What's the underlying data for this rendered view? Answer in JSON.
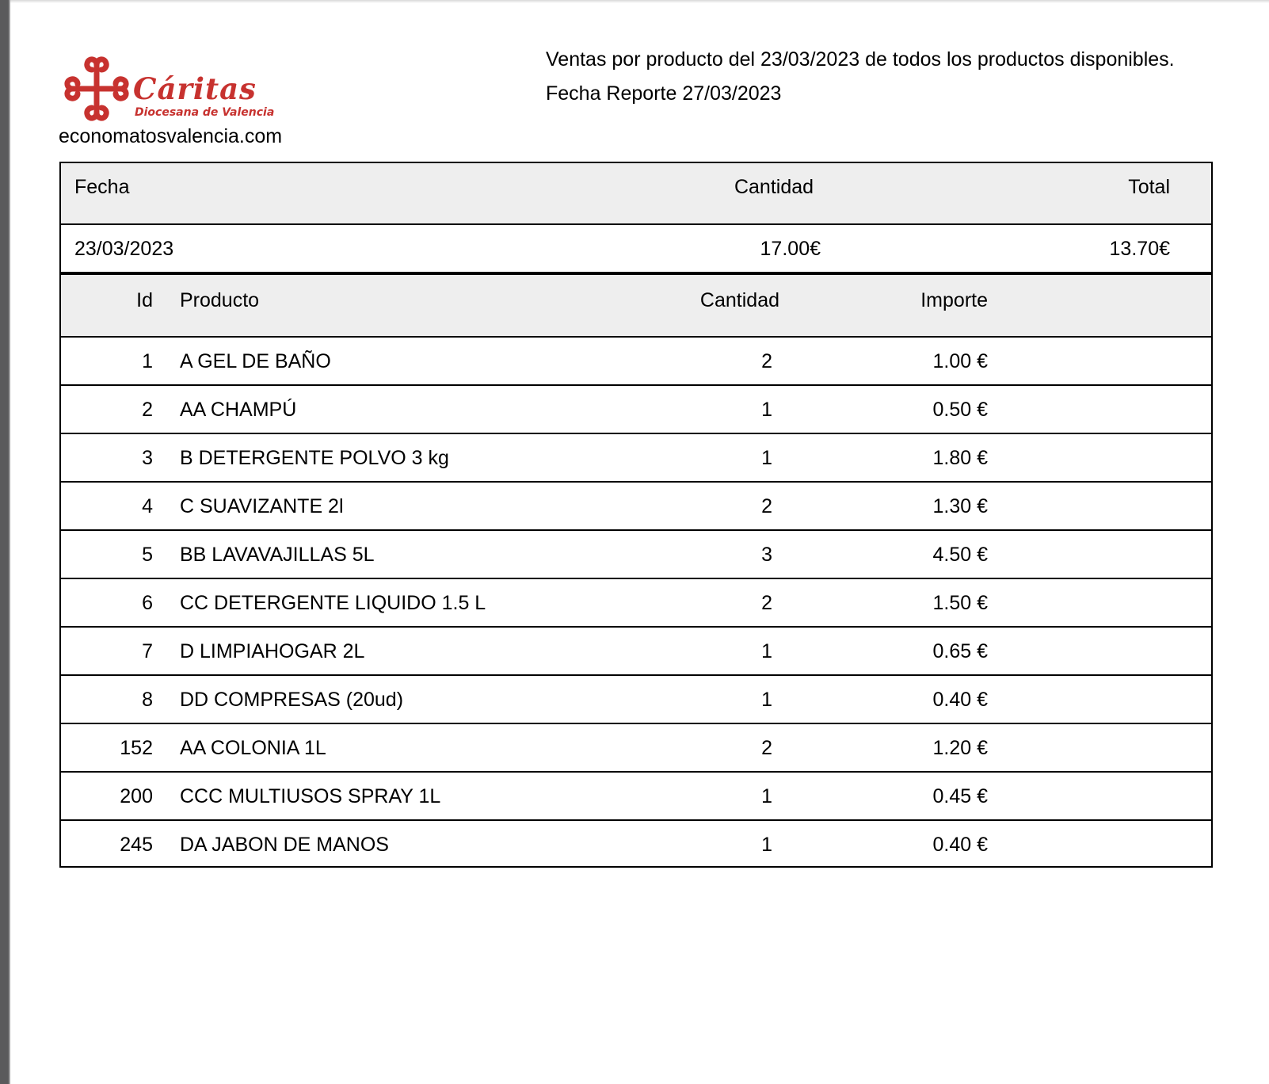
{
  "header": {
    "logo_name": "Cáritas",
    "logo_subtitle": "Diocesana de Valencia",
    "website": "economatosvalencia.com",
    "title": "Ventas por producto del 23/03/2023 de todos los productos disponibles.",
    "report_date": "Fecha Reporte 27/03/2023"
  },
  "colors": {
    "brand": "#c7322f",
    "header_bg": "#eeeeee"
  },
  "summary": {
    "headers": {
      "fecha": "Fecha",
      "cantidad": "Cantidad",
      "total": "Total"
    },
    "row": {
      "fecha": "23/03/2023",
      "cantidad": "17.00€",
      "total": "13.70€"
    }
  },
  "products": {
    "headers": {
      "id": "Id",
      "producto": "Producto",
      "cantidad": "Cantidad",
      "importe": "Importe"
    },
    "rows": [
      {
        "id": "1",
        "producto": "A GEL DE BAÑO",
        "cantidad": "2",
        "importe": "1.00 €"
      },
      {
        "id": "2",
        "producto": "AA CHAMPÚ",
        "cantidad": "1",
        "importe": "0.50 €"
      },
      {
        "id": "3",
        "producto": "B DETERGENTE POLVO 3 kg",
        "cantidad": "1",
        "importe": "1.80 €"
      },
      {
        "id": "4",
        "producto": "C SUAVIZANTE 2l",
        "cantidad": "2",
        "importe": "1.30 €"
      },
      {
        "id": "5",
        "producto": "BB LAVAVAJILLAS 5L",
        "cantidad": "3",
        "importe": "4.50 €"
      },
      {
        "id": "6",
        "producto": "CC DETERGENTE LIQUIDO 1.5 L",
        "cantidad": "2",
        "importe": "1.50 €"
      },
      {
        "id": "7",
        "producto": "D LIMPIAHOGAR 2L",
        "cantidad": "1",
        "importe": "0.65 €"
      },
      {
        "id": "8",
        "producto": "DD COMPRESAS (20ud)",
        "cantidad": "1",
        "importe": "0.40 €"
      },
      {
        "id": "152",
        "producto": "AA COLONIA 1L",
        "cantidad": "2",
        "importe": "1.20 €"
      },
      {
        "id": "200",
        "producto": "CCC MULTIUSOS SPRAY 1L",
        "cantidad": "1",
        "importe": "0.45 €"
      },
      {
        "id": "245",
        "producto": "DA JABON DE MANOS",
        "cantidad": "1",
        "importe": "0.40 €"
      }
    ]
  }
}
